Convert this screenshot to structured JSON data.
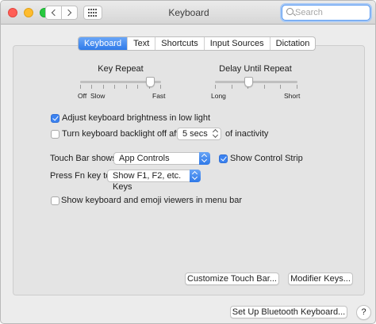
{
  "window": {
    "title": "Keyboard"
  },
  "search": {
    "placeholder": "Search"
  },
  "tabs": [
    {
      "label": "Keyboard",
      "active": true
    },
    {
      "label": "Text",
      "active": false
    },
    {
      "label": "Shortcuts",
      "active": false
    },
    {
      "label": "Input Sources",
      "active": false
    },
    {
      "label": "Dictation",
      "active": false
    }
  ],
  "key_repeat": {
    "title": "Key Repeat",
    "labels": [
      "Off",
      "Slow",
      "Fast"
    ],
    "ticks": 8,
    "value_fraction": 0.86
  },
  "delay_until_repeat": {
    "title": "Delay Until Repeat",
    "labels": [
      "Long",
      "Short"
    ],
    "ticks": 6,
    "value_fraction": 0.4
  },
  "options": {
    "brightness_label": "Adjust keyboard brightness in low light",
    "brightness_checked": true,
    "backlight_label": "Turn keyboard backlight off after",
    "backlight_checked": false,
    "backlight_value": "5 secs",
    "backlight_suffix": "of inactivity"
  },
  "touch_bar": {
    "label": "Touch Bar shows",
    "value": "App Controls",
    "strip_label": "Show Control Strip",
    "strip_checked": true
  },
  "fn_key": {
    "label": "Press Fn key to",
    "value": "Show F1, F2, etc. Keys"
  },
  "emoji_viewer": {
    "label": "Show keyboard and emoji viewers in menu bar",
    "checked": false
  },
  "buttons": {
    "customize_touch_bar": "Customize Touch Bar...",
    "modifier_keys": "Modifier Keys...",
    "bluetooth_keyboard": "Set Up Bluetooth Keyboard...",
    "help": "?"
  },
  "colors": {
    "accent": "#2f7ae9",
    "close": "#ff5f57",
    "minimize": "#febc2e",
    "zoom": "#28c840"
  }
}
